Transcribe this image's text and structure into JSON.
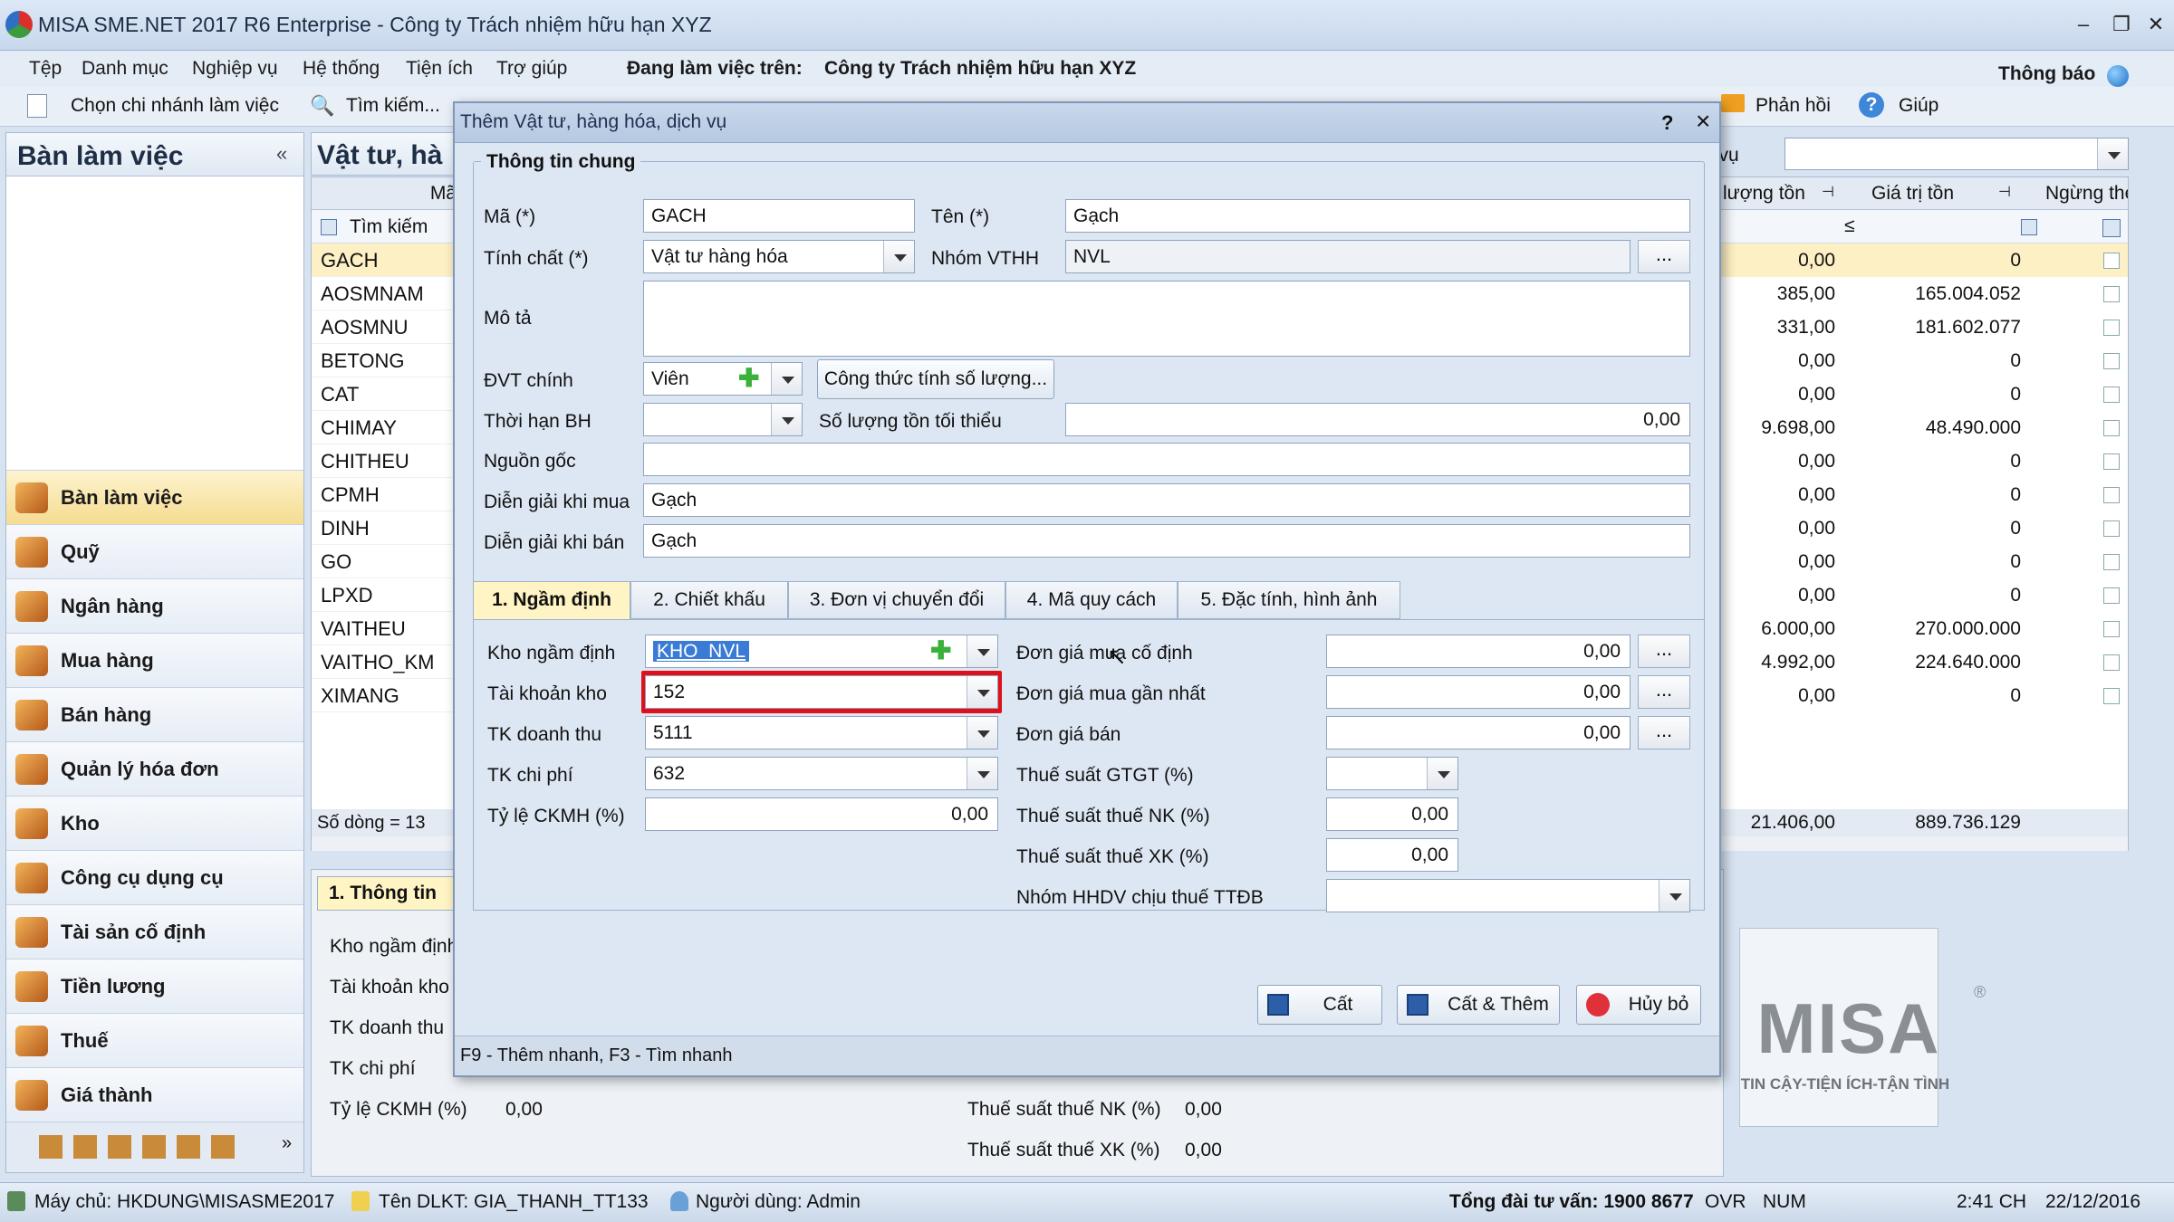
{
  "window": {
    "title": "MISA SME.NET 2017 R6 Enterprise - Công ty Trách nhiệm hữu hạn XYZ"
  },
  "menu": {
    "items": [
      "Tệp",
      "Danh mục",
      "Nghiệp vụ",
      "Hệ thống",
      "Tiện ích",
      "Trợ giúp"
    ],
    "working_label": "Đang làm việc trên:",
    "working_company": "Công ty Trách nhiệm hữu hạn XYZ",
    "notify": "Thông báo"
  },
  "toolbar": {
    "branch": "Chọn chi nhánh làm việc",
    "search": "Tìm kiếm...",
    "feedback": "Phản hồi",
    "help": "Giúp"
  },
  "sidebar": {
    "title": "Bàn làm việc",
    "items": [
      "Bàn làm việc",
      "Quỹ",
      "Ngân hàng",
      "Mua hàng",
      "Bán hàng",
      "Quản lý hóa đơn",
      "Kho",
      "Công cụ dụng cụ",
      "Tài sản cố định",
      "Tiền lương",
      "Thuế",
      "Giá thành"
    ]
  },
  "list": {
    "title": "Vật tư, hà",
    "col_code": "Mã",
    "search": "Tìm kiếm",
    "rows": [
      "GACH",
      "AOSMNAM",
      "AOSMNU",
      "BETONG",
      "CAT",
      "CHIMAY",
      "CHITHEU",
      "CPMH",
      "DINH",
      "GO",
      "LPXD",
      "VAITHEU",
      "VAITHO_KM",
      "XIMANG"
    ],
    "count": "Số dòng = 13",
    "detail_tab": "1. Thông tin"
  },
  "grid": {
    "filter_suffix": "h vụ",
    "col_qty": "lượng tồn",
    "col_value": "Giá trị tồn",
    "col_stop": "Ngừng theo dõ",
    "filter_op": "≤",
    "rows": [
      [
        "0,00",
        "0"
      ],
      [
        "385,00",
        "165.004.052"
      ],
      [
        "331,00",
        "181.602.077"
      ],
      [
        "0,00",
        "0"
      ],
      [
        "0,00",
        "0"
      ],
      [
        "9.698,00",
        "48.490.000"
      ],
      [
        "0,00",
        "0"
      ],
      [
        "0,00",
        "0"
      ],
      [
        "0,00",
        "0"
      ],
      [
        "0,00",
        "0"
      ],
      [
        "0,00",
        "0"
      ],
      [
        "6.000,00",
        "270.000.000"
      ],
      [
        "4.992,00",
        "224.640.000"
      ],
      [
        "0,00",
        "0"
      ]
    ],
    "total_qty": "21.406,00",
    "total_value": "889.736.129"
  },
  "dialog": {
    "title": "Thêm Vật tư, hàng hóa, dịch vụ",
    "help": "?",
    "close": "×",
    "section": "Thông tin chung",
    "code_label": "Mã (*)",
    "code": "GACH",
    "name_label": "Tên (*)",
    "name": "Gạch",
    "nature_label": "Tính chất (*)",
    "nature": "Vật tư hàng hóa",
    "group_label": "Nhóm VTHH",
    "group": "NVL",
    "desc_label": "Mô tả",
    "desc": "",
    "unit_label": "ĐVT chính",
    "unit": "Viên",
    "formula_button": "Công thức tính số lượng...",
    "warranty_label": "Thời hạn BH",
    "warranty": "",
    "min_qty_label": "Số lượng tồn tối thiểu",
    "min_qty": "0,00",
    "origin_label": "Nguồn gốc",
    "origin": "",
    "buy_desc_label": "Diễn giải khi mua",
    "buy_desc": "Gạch",
    "sell_desc_label": "Diễn giải khi bán",
    "sell_desc": "Gạch",
    "tabs": [
      "1. Ngầm định",
      "2. Chiết khấu",
      "3. Đơn vị chuyển đổi",
      "4. Mã quy cách",
      "5. Đặc tính, hình ảnh"
    ],
    "default_wh_label": "Kho ngầm định",
    "default_wh": "KHO_NVL",
    "stock_acc_label": "Tài khoản kho",
    "stock_acc": "152",
    "revenue_acc_label": "TK doanh thu",
    "revenue_acc": "5111",
    "cost_acc_label": "TK chi phí",
    "cost_acc": "632",
    "discount_label": "Tỷ lệ CKMH (%)",
    "discount": "0,00",
    "fixed_price_label": "Đơn giá mua cố định",
    "fixed_price": "0,00",
    "last_price_label": "Đơn giá mua gần nhất",
    "last_price": "0,00",
    "sale_price_label": "Đơn giá bán",
    "sale_price": "0,00",
    "vat_label": "Thuế suất GTGT (%)",
    "vat": "",
    "import_tax_label": "Thuế suất thuế NK (%)",
    "import_tax": "0,00",
    "export_tax_label": "Thuế suất thuế XK (%)",
    "export_tax": "0,00",
    "special_tax_label": "Nhóm HHDV chịu thuế TTĐB",
    "special_tax": "",
    "save": "Cất",
    "save_add": "Cất & Thêm",
    "cancel": "Hủy bỏ",
    "shortcut_hint": "F9 - Thêm nhanh, F3 - Tìm nhanh",
    "dots": "..."
  },
  "bottom": {
    "wh": "Kho ngầm định",
    "acc": "Tài khoản kho",
    "rev": "TK doanh thu",
    "cost": "TK chi phí",
    "disc": "Tỷ lệ CKMH (%)",
    "disc_val": "0,00",
    "nk": "Thuế suất thuế NK (%)",
    "nk_val": "0,00",
    "xk": "Thuế suất thuế XK (%)",
    "xk_val": "0,00"
  },
  "logo": {
    "brand": "MISA",
    "slogan": "TIN CẬY-TIỆN ÍCH-TẬN TÌNH",
    "reg": "®"
  },
  "status": {
    "server": "Máy chủ: HKDUNG\\MISASME2017",
    "db": "Tên DLKT: GIA_THANH_TT133",
    "user": "Người dùng: Admin",
    "hotline": "Tổng đài tư vấn: 1900 8677",
    "ovr": "OVR",
    "num": "NUM",
    "time": "2:41 CH",
    "date": "22/12/2016"
  }
}
